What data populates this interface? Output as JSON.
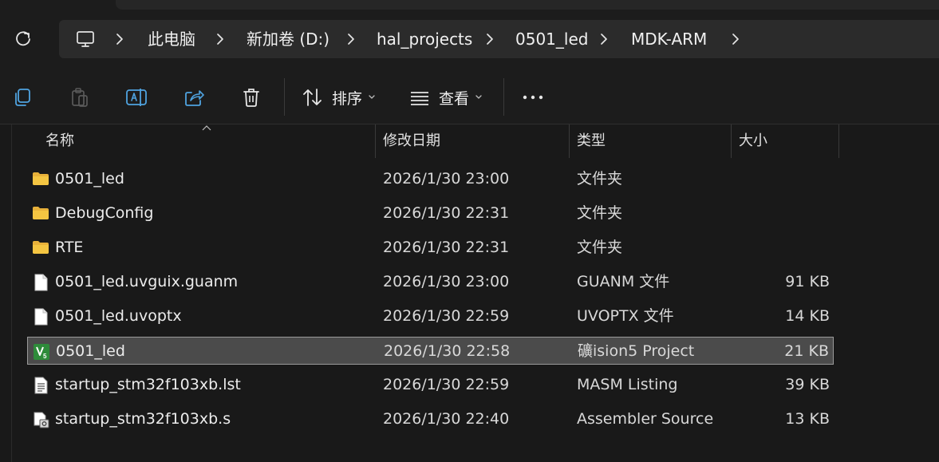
{
  "breadcrumb": {
    "items": [
      "此电脑",
      "新加卷 (D:)",
      "hal_projects",
      "0501_led",
      "MDK-ARM"
    ]
  },
  "toolbar": {
    "sort_label": "排序",
    "view_label": "查看"
  },
  "columns": {
    "name": "名称",
    "modified": "修改日期",
    "type": "类型",
    "size": "大小"
  },
  "files": [
    {
      "name": "0501_led",
      "modified": "2026/1/30 23:00",
      "type": "文件夹",
      "size": "",
      "icon": "folder-icon"
    },
    {
      "name": "DebugConfig",
      "modified": "2026/1/30 22:31",
      "type": "文件夹",
      "size": "",
      "icon": "folder-icon"
    },
    {
      "name": "RTE",
      "modified": "2026/1/30 22:31",
      "type": "文件夹",
      "size": "",
      "icon": "folder-icon"
    },
    {
      "name": "0501_led.uvguix.guanm",
      "modified": "2026/1/30 23:00",
      "type": "GUANM 文件",
      "size": "91 KB",
      "icon": "file-icon"
    },
    {
      "name": "0501_led.uvoptx",
      "modified": "2026/1/30 22:59",
      "type": "UVOPTX 文件",
      "size": "14 KB",
      "icon": "file-icon"
    },
    {
      "name": "0501_led",
      "modified": "2026/1/30 22:58",
      "type": "礦ision5 Project",
      "size": "21 KB",
      "icon": "keil-project-icon",
      "selected": true
    },
    {
      "name": "startup_stm32f103xb.lst",
      "modified": "2026/1/30 22:59",
      "type": "MASM Listing",
      "size": "39 KB",
      "icon": "text-file-icon"
    },
    {
      "name": "startup_stm32f103xb.s",
      "modified": "2026/1/30 22:40",
      "type": "Assembler Source",
      "size": "13 KB",
      "icon": "asm-file-icon"
    }
  ],
  "colors": {
    "background": "#191919",
    "selected_row": "#4b4b4b",
    "folder": "#f4c542",
    "keil_green": "#2e8b3a"
  }
}
